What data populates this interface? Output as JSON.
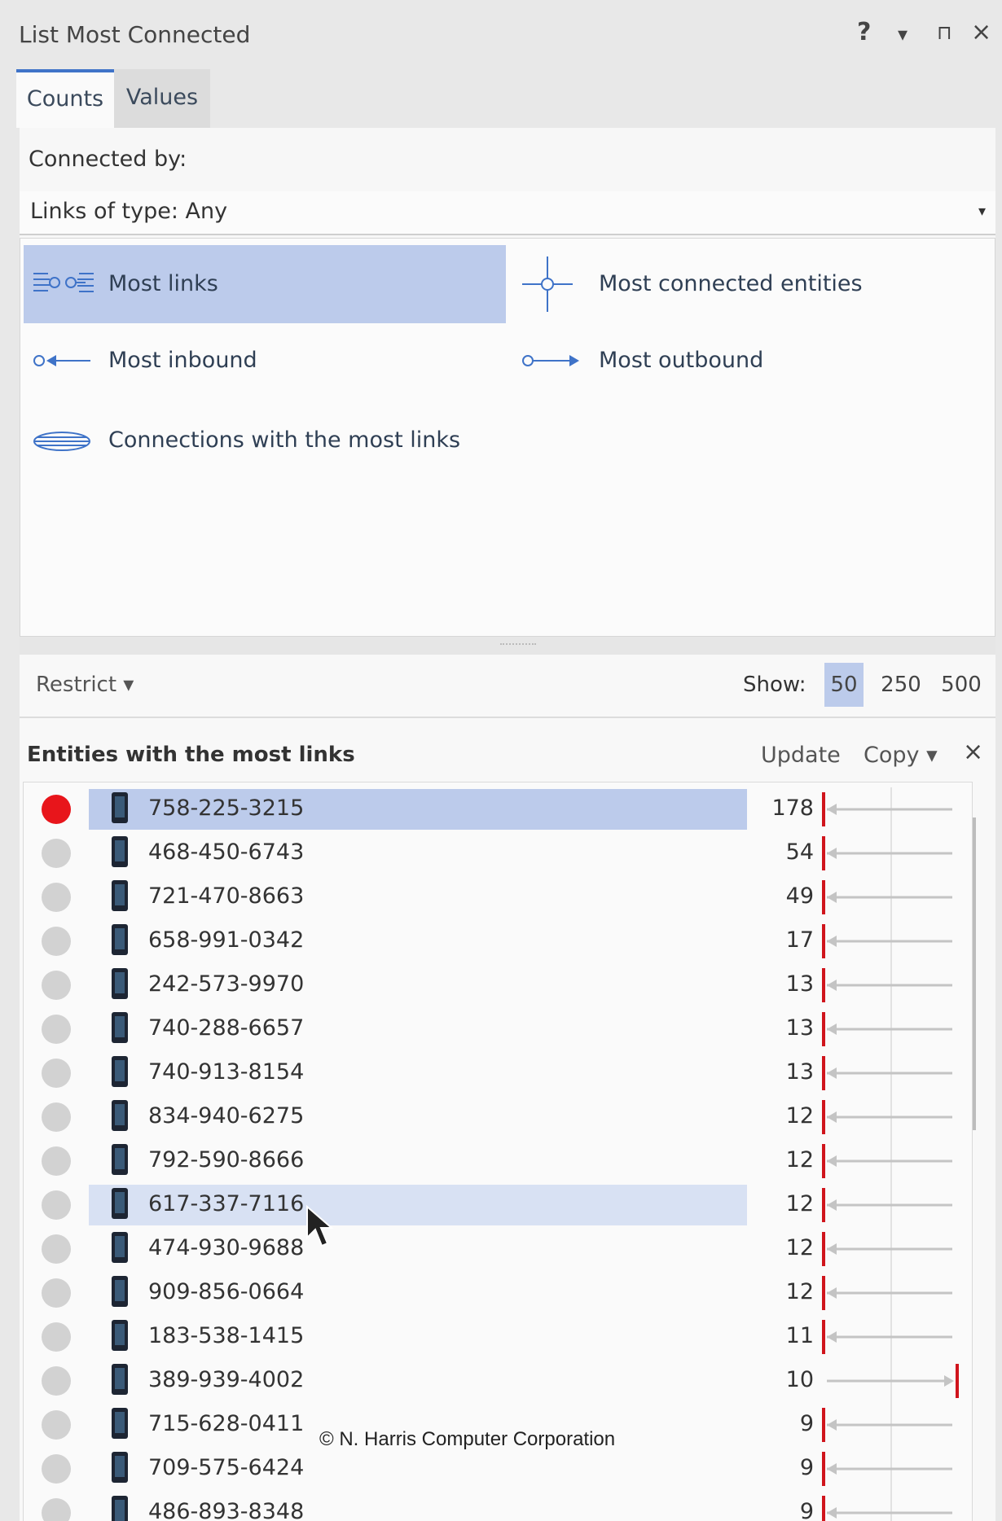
{
  "window": {
    "title": "List Most Connected",
    "controls": [
      "?",
      "▾",
      "⊓",
      "×"
    ]
  },
  "tabs": [
    {
      "label": "Counts",
      "active": true
    },
    {
      "label": "Values",
      "active": false
    }
  ],
  "connected_by": {
    "label": "Connected by:",
    "dropdown_value": "Links of type: Any"
  },
  "options": {
    "most_links": "Most links",
    "most_connected_entities": "Most connected entities",
    "most_inbound": "Most inbound",
    "most_outbound": "Most outbound",
    "connections_most_links": "Connections with the most links",
    "selected": "Most links"
  },
  "filter": {
    "restrict_label": "Restrict ▾",
    "show_label": "Show:",
    "show_options": [
      "50",
      "250",
      "500"
    ],
    "show_selected": "50"
  },
  "results": {
    "title": "Entities with the most links",
    "update_label": "Update",
    "copy_label": "Copy ▾",
    "close_label": "×",
    "rows": [
      {
        "number": "758-225-3215",
        "count": "178",
        "selected": true,
        "flagged": true,
        "direction": "in"
      },
      {
        "number": "468-450-6743",
        "count": "54",
        "direction": "in"
      },
      {
        "number": "721-470-8663",
        "count": "49",
        "direction": "in"
      },
      {
        "number": "658-991-0342",
        "count": "17",
        "direction": "in"
      },
      {
        "number": "242-573-9970",
        "count": "13",
        "direction": "in"
      },
      {
        "number": "740-288-6657",
        "count": "13",
        "direction": "in"
      },
      {
        "number": "740-913-8154",
        "count": "13",
        "direction": "in"
      },
      {
        "number": "834-940-6275",
        "count": "12",
        "direction": "in"
      },
      {
        "number": "792-590-8666",
        "count": "12",
        "direction": "in"
      },
      {
        "number": "617-337-7116",
        "count": "12",
        "hover": true,
        "direction": "in"
      },
      {
        "number": "474-930-9688",
        "count": "12",
        "direction": "in"
      },
      {
        "number": "909-856-0664",
        "count": "12",
        "direction": "in"
      },
      {
        "number": "183-538-1415",
        "count": "11",
        "direction": "in"
      },
      {
        "number": "389-939-4002",
        "count": "10",
        "direction": "out"
      },
      {
        "number": "715-628-0411",
        "count": "9",
        "direction": "in"
      },
      {
        "number": "709-575-6424",
        "count": "9",
        "direction": "in"
      },
      {
        "number": "486-893-8348",
        "count": "9",
        "direction": "in"
      }
    ]
  },
  "footer": "© N. Harris Computer Corporation",
  "colors": {
    "selection": "#bccbeb",
    "hover": "#d8e1f3",
    "accent": "#3f73c8",
    "flag_red": "#e8151b",
    "bar_red": "#d0141c",
    "arrow_gray": "#c4c4c4"
  }
}
